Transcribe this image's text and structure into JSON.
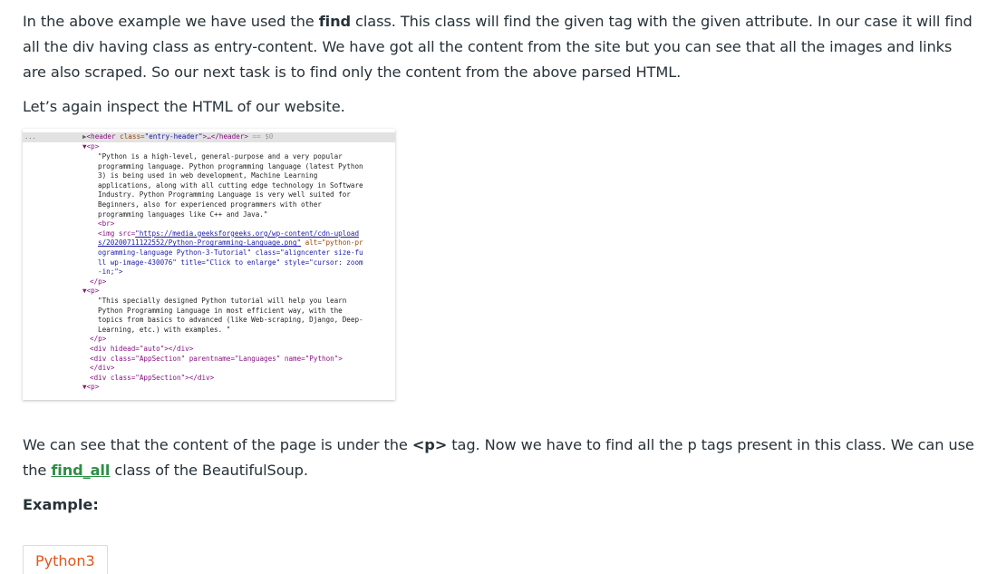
{
  "paragraphs": {
    "p1_a": "In the above example  we have used the ",
    "p1_b": "find",
    "p1_c": " class. This class will find the given tag with the given attribute. In our case it will find all the div having class as entry-content. We have got all the content from the site but you can see that all the images and links are also scraped. So our next task is to find only the content from the above parsed HTML.",
    "p2": "Let’s again inspect the HTML of our website.",
    "p3_a": "We can see that the content of the page is under the ",
    "p3_b": "<p>",
    "p3_c": " tag. Now we have to find all the p tags present in this class. We can use the ",
    "p3_link": "find_all",
    "p3_d": " class of the BeautifulSoup.",
    "example_label": "Example:"
  },
  "devtools": {
    "dots": "...",
    "header_line_arrow": "▶",
    "header_open": "<header",
    "header_attr": " class=",
    "header_val": "\"entry-header\"",
    "header_rest": ">…</header>",
    "header_eq": " == $0",
    "p_open_1": "▼<p>",
    "text_1": [
      "\"Python is a high-level, general-purpose and a very popular",
      "programming language. Python programming language (latest Python",
      "3) is being used in web development, Machine Learning",
      "applications, along with all cutting edge technology in Software",
      "Industry. Python Programming Language is very well suited for",
      "Beginners, also for experienced programmers with other",
      "programming languages like C++ and Java.\""
    ],
    "br": "<br>",
    "img_open": "<img src=",
    "img_url_1": "\"https://media.geeksforgeeks.org/wp-content/cdn-upload",
    "img_url_2": "s/20200711122552/Python-Programming-Language.png\"",
    "img_alt": " alt=\"python-pr",
    "img_line_3": "ogramming-language Python-3-Tutorial\" class=\"aligncenter size-fu",
    "img_line_4": "ll wp-image-430076\" title=\"Click to enlarge\" style=\"cursor: zoom",
    "img_line_5": "-in;\">",
    "p_close_1": "</p>",
    "p_open_2": "▼<p>",
    "text_2": [
      "\"This specially designed Python tutorial will help you learn",
      "Python Programming Language in most efficient way, with the",
      "topics from basics to advanced (like Web-scraping, Django, Deep-",
      "Learning, etc.) with examples. \""
    ],
    "p_close_2": "</p>",
    "div_1": "<div hidead=\"auto\"></div>",
    "div_2": "<div class=\"AppSection\" parentname=\"Languages\" name=\"Python\">",
    "div_2_close": "</div>",
    "div_3": "<div class=\"AppSection\"></div>",
    "p_open_3": "▼<p>"
  },
  "code_tab": {
    "label": "Python3"
  },
  "colors": {
    "link": "#2f8d46",
    "tab_text": "#e0551b",
    "text": "#273239"
  }
}
